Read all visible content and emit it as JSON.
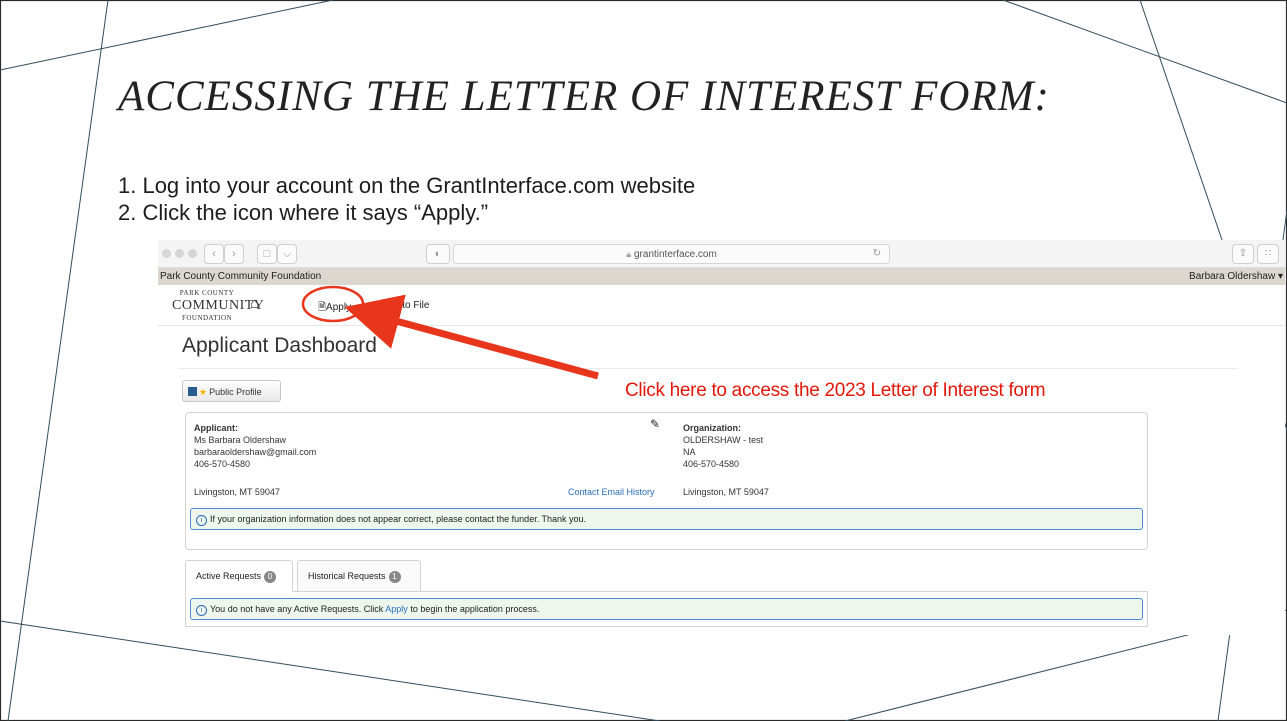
{
  "slide": {
    "title": "ACCESSING THE LETTER OF INTEREST FORM:",
    "steps": [
      "1. Log into your account on the GrantInterface.com website",
      "2. Click the icon where it says “Apply.”"
    ],
    "callout": "Click here to access the 2023 Letter of Interest form",
    "callout_color": "#e3170a"
  },
  "browser": {
    "url": "grantinterface.com",
    "org_name": "Park County Community Foundation",
    "user_menu": "Barbara Oldershaw ▾",
    "logo": {
      "line1": "PARK COUNTY",
      "line2": "COMMUNITY",
      "line3": "FOUNDATION"
    },
    "nav": {
      "home_icon": "home-icon",
      "apply_label": "Apply",
      "fax_label": "Fax to File"
    },
    "page_title": "Applicant Dashboard",
    "public_profile_label": "Public Profile",
    "applicant": {
      "heading": "Applicant:",
      "name": "Ms Barbara Oldershaw",
      "email": "barbaraoldershaw@gmail.com",
      "phone": "406-570-4580",
      "location": "Livingston, MT 59047"
    },
    "contact_email_history": "Contact Email History",
    "organization": {
      "heading": "Organization:",
      "name": "OLDERSHAW - test",
      "line2": "NA",
      "phone": "406-570-4580",
      "location": "Livingston, MT 59047"
    },
    "org_notice": "If your organization information does not appear correct, please contact the funder. Thank you.",
    "tabs": [
      {
        "label": "Active Requests",
        "count": "0"
      },
      {
        "label": "Historical Requests",
        "count": "1"
      }
    ],
    "active_notice_pre": "You do not have any Active Requests. Click",
    "active_notice_link": "Apply",
    "active_notice_post": "to begin the application process."
  }
}
